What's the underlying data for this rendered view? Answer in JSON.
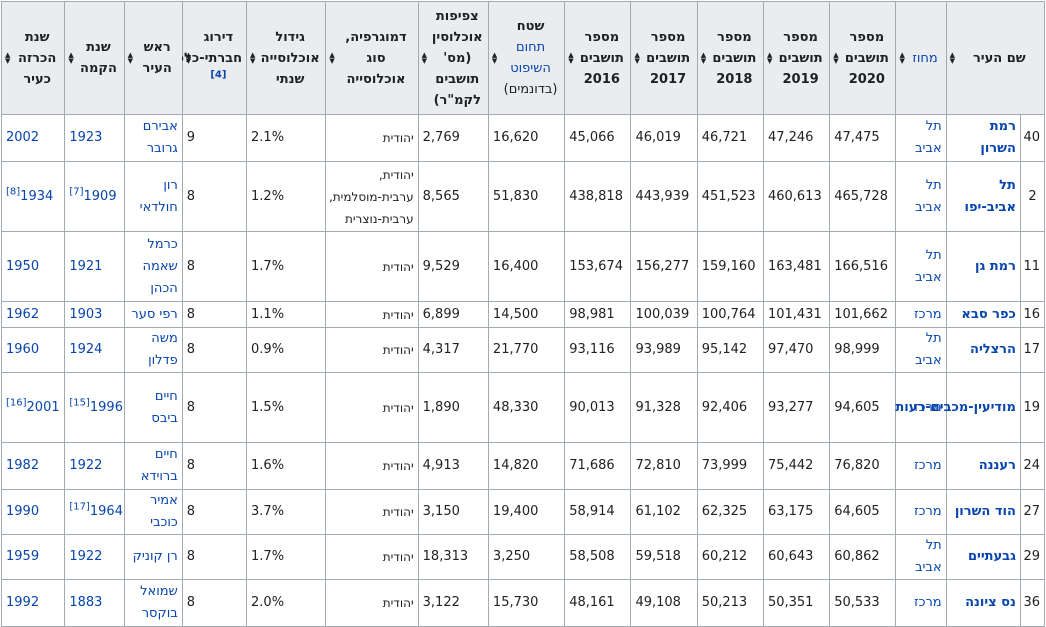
{
  "headers": [
    {
      "text": "שם העיר",
      "link": false
    },
    {
      "text": "מחוז",
      "link": true
    },
    {
      "text": "מספר תושבים 2020",
      "link": false
    },
    {
      "text": "מספר תושבים 2019",
      "link": false
    },
    {
      "text": "מספר תושבים 2018",
      "link": false
    },
    {
      "text": "מספר תושבים 2017",
      "link": false
    },
    {
      "text": "מספר תושבים 2016",
      "link": false
    },
    {
      "pre": "שטח",
      "linktext": "תחום השיפוט",
      "post": "(בדונמים)"
    },
    {
      "text": "צפיפות אוכלוסין (מס' תושבים לקמ\"ר)",
      "link": false
    },
    {
      "text": "דמוגרפיה, סוג אוכלוסייה",
      "link": false
    },
    {
      "text": "גידול אוכלוסייה שנתי",
      "link": false
    },
    {
      "text": "דירוג חברתי-כלכלי",
      "ref": "[4]"
    },
    {
      "text": "ראש העיר",
      "link": false
    },
    {
      "text": "שנת הקמה",
      "link": false
    },
    {
      "text": "שנת הכרזה כעיר",
      "link": false
    }
  ],
  "rows": [
    {
      "rank": "40",
      "city": "רמת השרון",
      "district": "תל אביב",
      "p2020": "47,475",
      "p2019": "47,246",
      "p2018": "46,721",
      "p2017": "46,019",
      "p2016": "45,066",
      "area": "16,620",
      "density": "2,769",
      "demo": "יהודית",
      "growth": "2.1%",
      "ses": "9",
      "mayor": "אבירם גרובר",
      "founded": "1923",
      "founded_ref": "",
      "city_year": "2002",
      "city_year_ref": ""
    },
    {
      "rank": "2",
      "city": "תל אביב-יפו",
      "district": "תל אביב",
      "p2020": "465,728",
      "p2019": "460,613",
      "p2018": "451,523",
      "p2017": "443,939",
      "p2016": "438,818",
      "area": "51,830",
      "density": "8,565",
      "demo": "יהודית, ערבית-מוסלמית, ערבית-נוצרית",
      "growth": "1.2%",
      "ses": "8",
      "mayor": "רון חולדאי",
      "founded": "1909",
      "founded_ref": "[7]",
      "city_year": "1934",
      "city_year_ref": "[8]"
    },
    {
      "rank": "11",
      "city": "רמת גן",
      "district": "תל אביב",
      "p2020": "166,516",
      "p2019": "163,481",
      "p2018": "159,160",
      "p2017": "156,277",
      "p2016": "153,674",
      "area": "16,400",
      "density": "9,529",
      "demo": "יהודית",
      "growth": "1.7%",
      "ses": "8",
      "mayor": "כרמל שאמה הכהן",
      "founded": "1921",
      "founded_ref": "",
      "city_year": "1950",
      "city_year_ref": ""
    },
    {
      "rank": "16",
      "city": "כפר סבא",
      "district": "מרכז",
      "p2020": "101,662",
      "p2019": "101,431",
      "p2018": "100,764",
      "p2017": "100,039",
      "p2016": "98,981",
      "area": "14,500",
      "density": "6,899",
      "demo": "יהודית",
      "growth": "1.1%",
      "ses": "8",
      "mayor": "רפי סער",
      "founded": "1903",
      "founded_ref": "",
      "city_year": "1962",
      "city_year_ref": ""
    },
    {
      "rank": "17",
      "city": "הרצליה",
      "district": "תל אביב",
      "p2020": "98,999",
      "p2019": "97,470",
      "p2018": "95,142",
      "p2017": "93,989",
      "p2016": "93,116",
      "area": "21,770",
      "density": "4,317",
      "demo": "יהודית",
      "growth": "0.9%",
      "ses": "8",
      "mayor": "משה פדלון",
      "founded": "1924",
      "founded_ref": "",
      "city_year": "1960",
      "city_year_ref": ""
    },
    {
      "rank": "19",
      "city": "מודיעין-מכבים-רעות",
      "district": "מרכז",
      "p2020": "94,605",
      "p2019": "93,277",
      "p2018": "92,406",
      "p2017": "91,328",
      "p2016": "90,013",
      "area": "48,330",
      "density": "1,890",
      "demo": "יהודית",
      "growth": "1.5%",
      "ses": "8",
      "mayor": "חיים ביבס",
      "founded": "1996",
      "founded_ref": "[15]",
      "city_year": "2001",
      "city_year_ref": "[16]"
    },
    {
      "rank": "24",
      "city": "רעננה",
      "district": "מרכז",
      "p2020": "76,820",
      "p2019": "75,442",
      "p2018": "73,999",
      "p2017": "72,810",
      "p2016": "71,686",
      "area": "14,820",
      "density": "4,913",
      "demo": "יהודית",
      "growth": "1.6%",
      "ses": "8",
      "mayor": "חיים ברוידא",
      "founded": "1922",
      "founded_ref": "",
      "city_year": "1982",
      "city_year_ref": ""
    },
    {
      "rank": "27",
      "city": "הוד השרון",
      "district": "מרכז",
      "p2020": "64,605",
      "p2019": "63,175",
      "p2018": "62,325",
      "p2017": "61,102",
      "p2016": "58,914",
      "area": "19,400",
      "density": "3,150",
      "demo": "יהודית",
      "growth": "3.7%",
      "ses": "8",
      "mayor": "אמיר כוכבי",
      "founded": "1964",
      "founded_ref": "[17]",
      "city_year": "1990",
      "city_year_ref": ""
    },
    {
      "rank": "29",
      "city": "גבעתיים",
      "district": "תל אביב",
      "p2020": "60,862",
      "p2019": "60,643",
      "p2018": "60,212",
      "p2017": "59,518",
      "p2016": "58,508",
      "area": "3,250",
      "density": "18,313",
      "demo": "יהודית",
      "growth": "1.7%",
      "ses": "8",
      "mayor": "רן קוניק",
      "founded": "1922",
      "founded_ref": "",
      "city_year": "1959",
      "city_year_ref": ""
    },
    {
      "rank": "36",
      "city": "נס ציונה",
      "district": "מרכז",
      "p2020": "50,533",
      "p2019": "50,351",
      "p2018": "50,213",
      "p2017": "49,108",
      "p2016": "48,161",
      "area": "15,730",
      "density": "3,122",
      "demo": "יהודית",
      "growth": "2.0%",
      "ses": "8",
      "mayor": "שמואל בוקסר",
      "founded": "1883",
      "founded_ref": "",
      "city_year": "1992",
      "city_year_ref": ""
    }
  ]
}
